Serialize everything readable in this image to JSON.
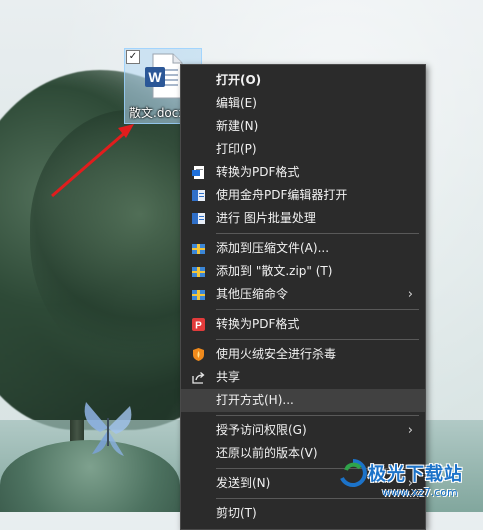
{
  "desktop": {
    "file": {
      "name": "散文.docx",
      "checkbox": "✓",
      "icon": "word-document-icon",
      "accent": "#2b5797"
    }
  },
  "context_menu": {
    "items": [
      {
        "label": "打开(O)",
        "bold": true
      },
      {
        "label": "编辑(E)"
      },
      {
        "label": "新建(N)"
      },
      {
        "label": "打印(P)"
      },
      {
        "label": "转换为PDF格式",
        "icon": "pdf-convert-icon"
      },
      {
        "label": "使用金舟PDF编辑器打开",
        "icon": "pdf-editor-icon"
      },
      {
        "label": "进行 图片批量处理",
        "icon": "image-batch-icon"
      },
      {
        "label": "添加到压缩文件(A)...",
        "icon": "archive-icon"
      },
      {
        "label": "添加到 \"散文.zip\" (T)",
        "icon": "archive-icon"
      },
      {
        "label": "其他压缩命令",
        "icon": "archive-icon",
        "submenu": "›"
      },
      {
        "label": "转换为PDF格式",
        "icon": "pdf-red-icon"
      },
      {
        "label": "使用火绒安全进行杀毒",
        "icon": "huorong-shield-icon"
      },
      {
        "label": "共享",
        "icon": "share-icon"
      },
      {
        "label": "打开方式(H)...",
        "highlighted": true
      },
      {
        "label": "授予访问权限(G)",
        "submenu": "›"
      },
      {
        "label": "还原以前的版本(V)"
      },
      {
        "label": "发送到(N)",
        "submenu": "›"
      },
      {
        "label": "剪切(T)"
      }
    ]
  },
  "watermark": {
    "text": "极光下载站",
    "url": "www.xz7.com"
  },
  "colors": {
    "menu_bg": "#2b2b2b",
    "menu_hover": "#414141",
    "arrow": "#e11d1d"
  }
}
